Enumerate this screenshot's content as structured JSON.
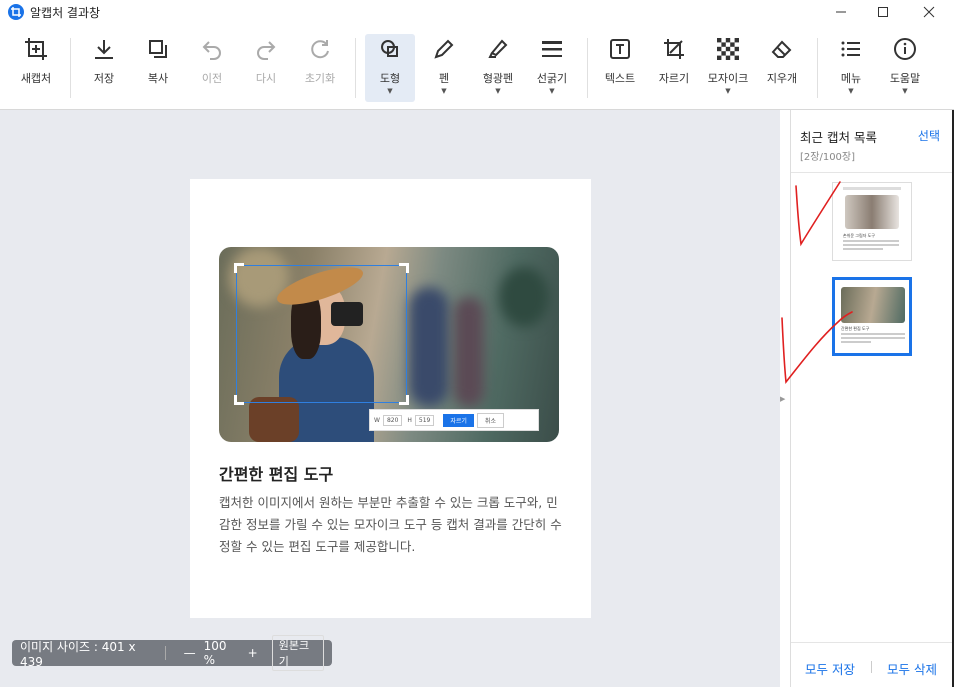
{
  "window": {
    "title": "알캡처 결과창"
  },
  "toolbar": {
    "items": [
      {
        "label": "새캡처",
        "icon": "new-capture-icon",
        "enabled": true
      },
      {
        "label": "저장",
        "icon": "download-icon",
        "enabled": true
      },
      {
        "label": "복사",
        "icon": "copy-icon",
        "enabled": true
      },
      {
        "label": "이전",
        "icon": "undo-icon",
        "enabled": false
      },
      {
        "label": "다시",
        "icon": "redo-icon",
        "enabled": false
      },
      {
        "label": "초기화",
        "icon": "reset-icon",
        "enabled": false
      },
      {
        "label": "도형",
        "icon": "shape-icon",
        "enabled": true,
        "active": true,
        "dropdown": true
      },
      {
        "label": "펜",
        "icon": "pen-icon",
        "enabled": true,
        "dropdown": true
      },
      {
        "label": "형광펜",
        "icon": "highlighter-icon",
        "enabled": true,
        "dropdown": true
      },
      {
        "label": "선굵기",
        "icon": "line-width-icon",
        "enabled": true,
        "dropdown": true
      },
      {
        "label": "텍스트",
        "icon": "text-icon",
        "enabled": true
      },
      {
        "label": "자르기",
        "icon": "crop-icon",
        "enabled": true
      },
      {
        "label": "모자이크",
        "icon": "mosaic-icon",
        "enabled": true,
        "dropdown": true
      },
      {
        "label": "지우개",
        "icon": "eraser-icon",
        "enabled": true
      },
      {
        "label": "메뉴",
        "icon": "menu-icon",
        "enabled": true,
        "dropdown": true
      },
      {
        "label": "도움말",
        "icon": "help-icon",
        "enabled": true,
        "dropdown": true
      }
    ]
  },
  "canvas": {
    "card": {
      "title": "간편한 편집 도구",
      "description": "캡처한 이미지에서 원하는 부분만 추출할 수 있는 크롭 도구와, 민감한 정보를 가릴 수 있는 모자이크 도구 등 캡처 결과를 간단히 수정할 수 있는 편집 도구를 제공합니다.",
      "crop_bar": {
        "w_label": "W",
        "w_value": "820",
        "h_label": "H",
        "h_value": "519",
        "ok": "자르기",
        "cancel": "취소"
      }
    }
  },
  "status": {
    "image_size": "이미지 사이즈 : 401 x 439",
    "zoom_minus": "—",
    "zoom": "100 %",
    "zoom_plus": "+",
    "original_size": "원본크기"
  },
  "panel": {
    "title": "최근 캡처 목록",
    "select": "선택",
    "count": "[2장/100장]",
    "save_all": "모두 저장",
    "delete_all": "모두 삭제",
    "thumb1_caption": "손쉬운 그림자 도구",
    "thumb2_caption": "간편한 편집 도구",
    "thumb2_selected": true
  },
  "colors": {
    "accent": "#1a73e8",
    "annotation": "#e02020",
    "canvas_bg": "#e8eaef"
  }
}
